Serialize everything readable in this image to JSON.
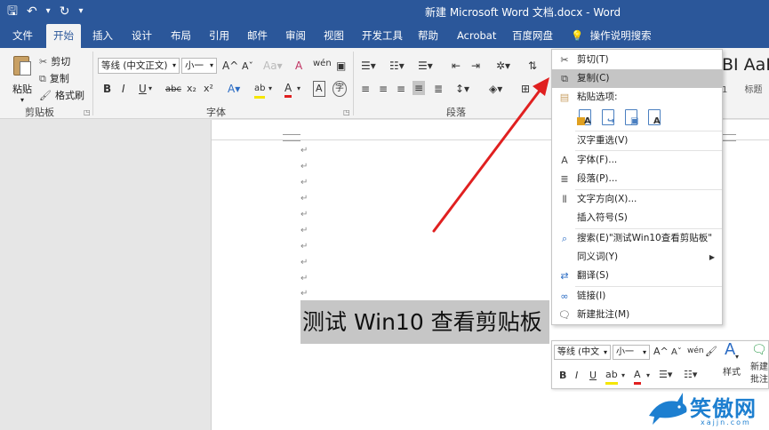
{
  "window": {
    "title": "新建 Microsoft Word 文档.docx  -  Word",
    "qat": {
      "save_icon": "save-icon",
      "undo_icon": "undo-icon",
      "redo_icon": "redo-icon",
      "customize_icon": "qat-customize-icon"
    }
  },
  "tabs": [
    {
      "label": "文件"
    },
    {
      "label": "开始"
    },
    {
      "label": "插入"
    },
    {
      "label": "设计"
    },
    {
      "label": "布局"
    },
    {
      "label": "引用"
    },
    {
      "label": "邮件"
    },
    {
      "label": "审阅"
    },
    {
      "label": "视图"
    },
    {
      "label": "开发工具"
    },
    {
      "label": "帮助"
    },
    {
      "label": "Acrobat"
    },
    {
      "label": "百度网盘"
    }
  ],
  "active_tab": "开始",
  "tell_me": "操作说明搜索",
  "ribbon": {
    "clipboard": {
      "paste": "粘贴",
      "cut": "剪切",
      "copy": "复制",
      "format_painter": "格式刷",
      "group_label": "剪贴板"
    },
    "font": {
      "font_name": "等线 (中文正文)",
      "font_size": "小一",
      "group_label": "字体",
      "grow": "A",
      "shrink": "A",
      "clear": "A",
      "phonetic": "wén",
      "bold": "B",
      "italic": "I",
      "underline": "U",
      "strike": "abc",
      "subscript": "x₂",
      "superscript": "x²",
      "effects": "A",
      "highlight": "ab",
      "color": "A",
      "enclose": "字"
    },
    "paragraph": {
      "group_label": "段落"
    },
    "styles": {
      "preview": "BI  AaI",
      "label1": "1",
      "label2": "标题"
    }
  },
  "document": {
    "selected_text": "测试 Win10 查看剪贴板",
    "paragraph_mark": "↵"
  },
  "context_menu": {
    "items": [
      {
        "label": "剪切(T)",
        "icon": "scissors-icon"
      },
      {
        "label": "复制(C)",
        "icon": "copy-icon",
        "highlighted": true
      },
      {
        "label": "粘贴选项:",
        "icon": "paste-icon"
      },
      {
        "label": "汉字重选(V)",
        "icon": ""
      },
      {
        "label": "字体(F)...",
        "icon": "font-icon"
      },
      {
        "label": "段落(P)...",
        "icon": "paragraph-icon"
      },
      {
        "label": "文字方向(X)...",
        "icon": "text-direction-icon"
      },
      {
        "label": "插入符号(S)",
        "icon": ""
      },
      {
        "label": "搜索(E)\"测试Win10查看剪贴板\"",
        "icon": "search-icon"
      },
      {
        "label": "同义词(Y)",
        "icon": "",
        "submenu": true
      },
      {
        "label": "翻译(S)",
        "icon": "translate-icon"
      },
      {
        "label": "链接(I)",
        "icon": "link-icon"
      },
      {
        "label": "新建批注(M)",
        "icon": "comment-icon"
      }
    ],
    "paste_options": [
      "A",
      "",
      "",
      "A"
    ]
  },
  "mini_toolbar": {
    "font_name": "等线 (中文",
    "font_size": "小一",
    "styles": "样式",
    "new_comment_1": "新建",
    "new_comment_2": "批注",
    "bold": "B",
    "italic": "I",
    "underline": "U"
  },
  "watermark": {
    "text": "笑傲网",
    "url": "xajjn.com"
  },
  "colors": {
    "title_bg": "#2b579a",
    "ribbon_bg": "#f3f3f3",
    "selection": "#c6c6c6",
    "highlight": "#c5c5c5",
    "arrow": "#e02020"
  }
}
